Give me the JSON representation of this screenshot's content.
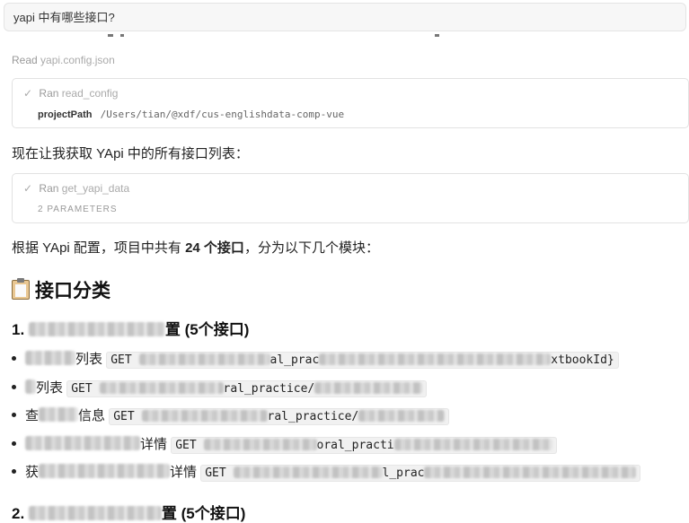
{
  "query": "yapi 中有哪些接口?",
  "read": {
    "prefix": "Read",
    "file": "yapi.config.json"
  },
  "tool1": {
    "status": "Ran",
    "name": "read_config",
    "param_key": "projectPath",
    "param_value": "/Users/tian/@xdf/cus-englishdata-comp-vue"
  },
  "text1": "现在让我获取 YApi 中的所有接口列表：",
  "tool2": {
    "status": "Ran",
    "name": "get_yapi_data",
    "meta": "2 PARAMETERS"
  },
  "text2": {
    "pre": "根据 YApi 配置，项目中共有 ",
    "strong": "24 个接口",
    "post": "，分为以下几个模块："
  },
  "section_title": "接口分类",
  "category1": {
    "num": "1.",
    "tail": "置 (5个接口)"
  },
  "items": [
    {
      "lead": "",
      "label": "列表",
      "method": "GET",
      "code_a": "",
      "code_b": "al_prac",
      "code_c": "xtbookId}"
    },
    {
      "lead": "",
      "label": "列表",
      "method": "GET",
      "code_a": "",
      "code_b": "ral_practice/",
      "code_c": ""
    },
    {
      "lead": "查",
      "label": "信息",
      "method": "GET",
      "code_a": "",
      "code_b": "ral_practice/",
      "code_c": ""
    },
    {
      "lead": "",
      "label": "详情",
      "method": "GET",
      "code_a": "",
      "code_b": "oral_practi",
      "code_c": ""
    },
    {
      "lead": "获",
      "label": "详情",
      "method": "GET",
      "code_a": "",
      "code_b": "l_prac",
      "code_c": ""
    }
  ],
  "category2": {
    "num": "2.",
    "tail": "置 (5个接口)"
  }
}
